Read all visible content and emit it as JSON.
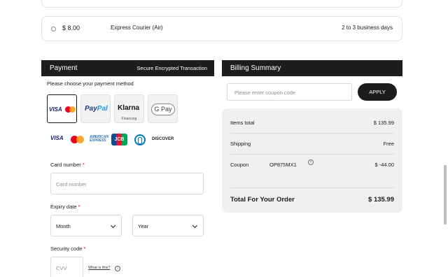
{
  "shipping": {
    "price": "$ 8.00",
    "name": "Express Courier (Air)",
    "days": "2 to 3 business days"
  },
  "payment": {
    "title": "Payment",
    "secure": "Secure Encrypted Transaction",
    "choose_label": "Please choose your payment method",
    "methods": {
      "visa": "VISA",
      "paypal_a": "Pay",
      "paypal_b": "Pal",
      "klarna": "Klarna",
      "klarna_sub": "Financing",
      "gpay": "G Pay"
    },
    "logos": {
      "visa": "VISA",
      "amex": "AMERICAN EXPRESS",
      "jcb": "JCB",
      "discover": "DISCOVER"
    },
    "card_number_label": "Card number",
    "card_number_placeholder": "Card number",
    "expiry_label": "Expiry date",
    "month_value": "Month",
    "year_value": "Year",
    "security_label": "Security code",
    "cvv_placeholder": "CVV",
    "what_link": "What is this?",
    "required_mark": "*"
  },
  "billing": {
    "title": "Billing Summary",
    "coupon_placeholder": "Please enter coupon code",
    "apply_label": "APPLY",
    "items_label": "Items total",
    "items_value": "$ 135.99",
    "shipping_label": "Shipping",
    "shipping_value": "Free",
    "coupon_label": "Coupon",
    "coupon_code": "OP875MX1",
    "coupon_value": "$ -44.00",
    "total_label": "Total For Your Order",
    "total_value": "$ 135.99"
  }
}
